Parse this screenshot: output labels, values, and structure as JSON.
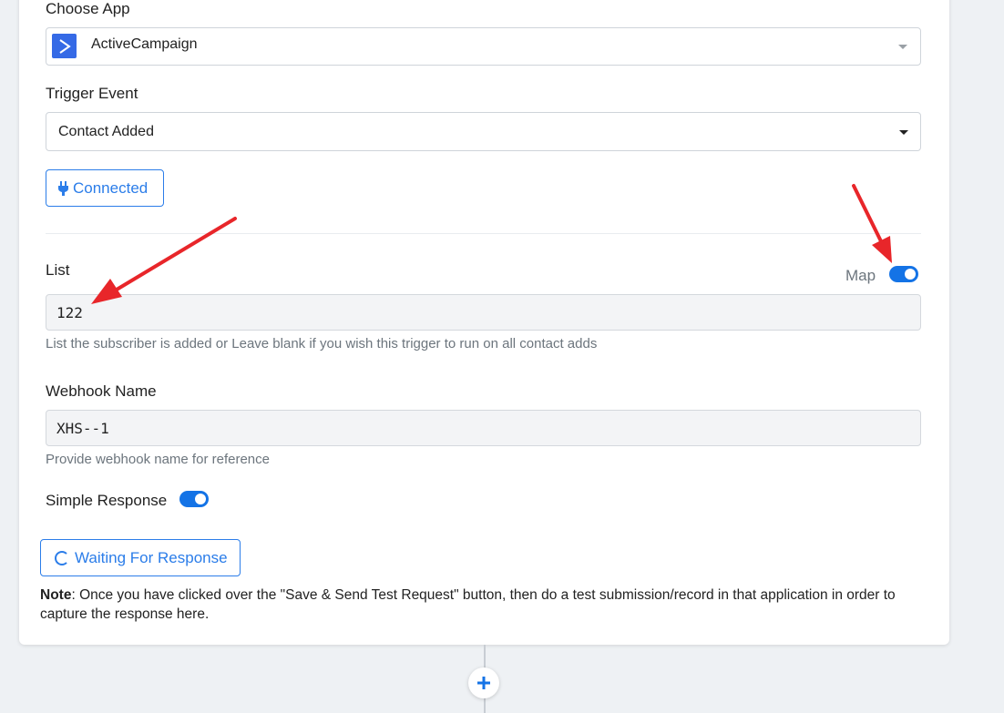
{
  "choose_app": {
    "label": "Choose App",
    "value": "ActiveCampaign",
    "logo_icon": "chevron-right-icon",
    "brand_color": "#356ae6"
  },
  "trigger_event": {
    "label": "Trigger Event",
    "value": "Contact Added"
  },
  "connected_button": {
    "label": "Connected",
    "icon": "plug-icon"
  },
  "list": {
    "label": "List",
    "value": "122",
    "help": "List the subscriber is added or Leave blank if you wish this trigger to run on all contact adds",
    "map_label": "Map",
    "map_enabled": true
  },
  "webhook": {
    "label": "Webhook Name",
    "value": "XHS--1",
    "help": "Provide webhook name for reference"
  },
  "simple_response": {
    "label": "Simple Response",
    "enabled": true
  },
  "waiting_button": {
    "label": "Waiting For Response",
    "icon": "spinner-icon"
  },
  "note": {
    "prefix": "Note",
    "text": ": Once you have clicked over the \"Save & Send Test Request\" button, then do a test submission/record in that application in order to capture the response here."
  },
  "add_step": {
    "icon": "plus-icon"
  },
  "colors": {
    "accent": "#2b7de9",
    "toggle_on": "#1473e6",
    "annotation_arrow": "#e8262a"
  }
}
